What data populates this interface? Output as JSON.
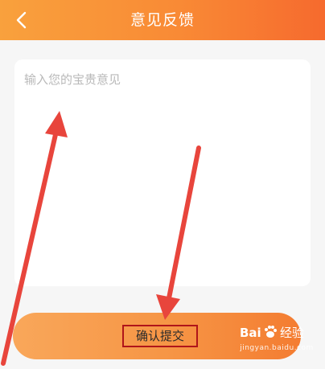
{
  "header": {
    "back_icon": "chevron-left-icon",
    "title": "意见反馈"
  },
  "feedback": {
    "placeholder": "输入您的宝贵意见",
    "value": ""
  },
  "submit": {
    "label": "确认提交"
  },
  "watermark": {
    "logo_text": "Bai 经验",
    "url": "jingyan.baidu.com"
  },
  "colors": {
    "header_start": "#f9a13d",
    "header_end": "#f66a2e",
    "annotation_arrow": "#e8453c",
    "annotation_box": "#b0151a"
  }
}
